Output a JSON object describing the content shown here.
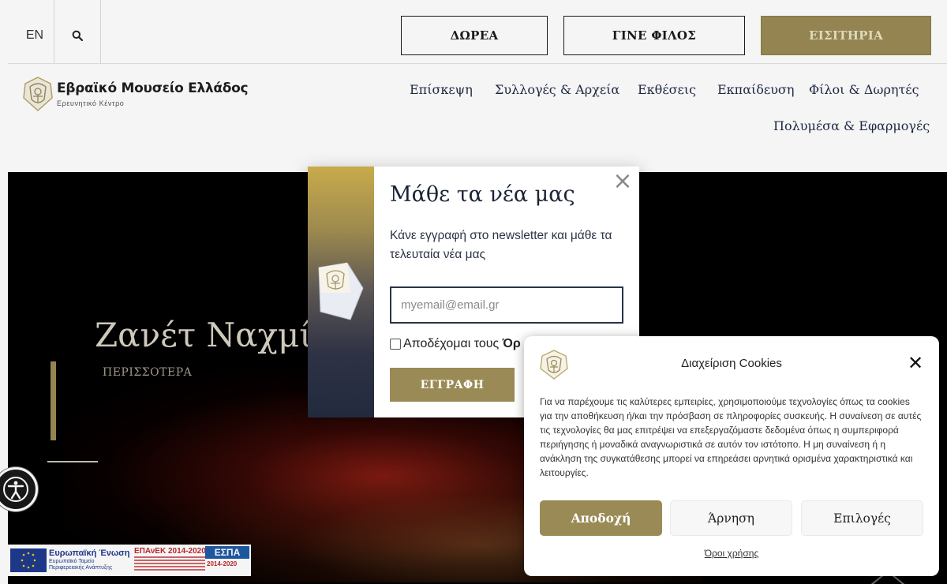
{
  "top_bar": {
    "language": "EN",
    "buttons": {
      "donate": "ΔΩΡΕΑ",
      "become_friend": "ΓΙΝΕ ΦΙΛΟΣ",
      "tickets": "ΕΙΣΙΤΗΡΙΑ"
    }
  },
  "logo": {
    "title": "Εβραϊκό Μουσείο Ελλάδος",
    "subtitle": "Ερευνητικό Κέντρο"
  },
  "nav": {
    "items": [
      "Επίσκεψη",
      "Συλλογές & Αρχεία",
      "Εκθέσεις",
      "Εκπαίδευση",
      "Φίλοι & Δωρητές",
      "Πολυμέσα & Εφαρμογές"
    ]
  },
  "hero": {
    "title": "Ζανέτ Ναχμία",
    "more_link": "ΠΕΡΙΣΣΟΤΕΡΑ"
  },
  "eu_banner": {
    "eu_title": "Ευρωπαϊκή Ένωση",
    "eu_line1": "Ευρωπαϊκό Ταμείο",
    "eu_line2": "Περιφερειακής Ανάπτυξης",
    "epanek": "ΕΠΑνΕΚ 2014-2020",
    "espa": "ΕΣΠΑ",
    "espa_years": "2014-2020"
  },
  "newsletter_popup": {
    "title": "Μάθε τα νέα μας",
    "text": "Κάνε εγγραφή στο newsletter και μάθε τα τελευταία νέα μας",
    "email_placeholder": "myemail@email.gr",
    "accept_text": "Αποδέχομαι τους ",
    "accept_terms": "Όρ",
    "submit": "ΕΓΓΡΑΦΗ",
    "close": "×"
  },
  "cookie_panel": {
    "title": "Διαχείριση Cookies",
    "close": "✕",
    "text": "Για να παρέχουμε τις καλύτερες εμπειρίες, χρησιμοποιούμε τεχνολογίες όπως τα cookies για την αποθήκευση ή/και την πρόσβαση σε πληροφορίες συσκευής. Η συναίνεση σε αυτές τις τεχνολογίες θα μας επιτρέψει να επεξεργαζόμαστε δεδομένα όπως η συμπεριφορά περιήγησης ή μοναδικά αναγνωριστικά σε αυτόν τον ιστότοπο. Η μη συναίνεση ή η ανάκληση της συγκατάθεσης μπορεί να επηρεάσει αρνητικά ορισμένα χαρακτηριστικά και λειτουργίες.",
    "accept": "Αποδοχή",
    "deny": "Άρνηση",
    "preferences": "Επιλογές",
    "terms": "Όροι χρήσης"
  },
  "icons": {
    "search": "search-icon",
    "accessibility": "accessibility-icon",
    "museum_emblem": "museum-emblem-icon"
  },
  "colors": {
    "gold": "#9a8a55",
    "navy": "#1c2436"
  }
}
